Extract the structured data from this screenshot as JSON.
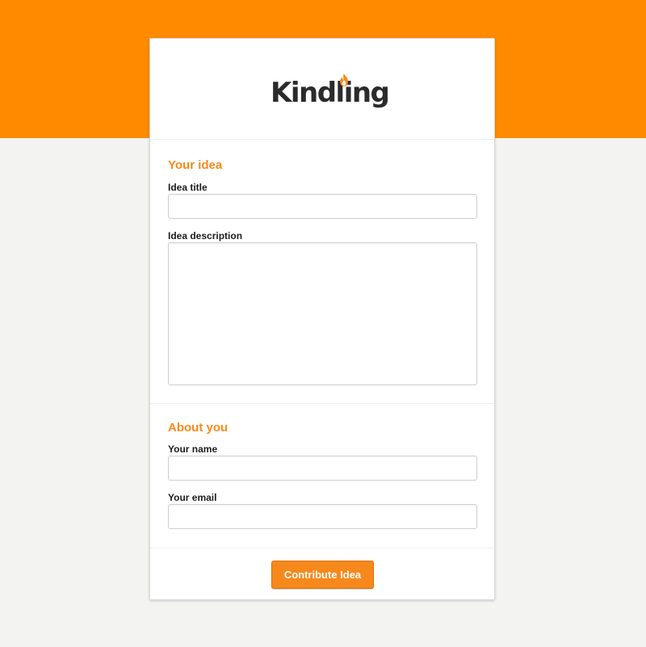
{
  "brand": {
    "name": "Kindling",
    "accent_color": "#ff8a00",
    "button_color": "#f7891c"
  },
  "sections": {
    "idea": {
      "title": "Your idea",
      "title_field_label": "Idea title",
      "title_field_value": "",
      "description_field_label": "Idea description",
      "description_field_value": ""
    },
    "about": {
      "title": "About you",
      "name_field_label": "Your name",
      "name_field_value": "",
      "email_field_label": "Your email",
      "email_field_value": ""
    }
  },
  "actions": {
    "submit_label": "Contribute Idea"
  }
}
